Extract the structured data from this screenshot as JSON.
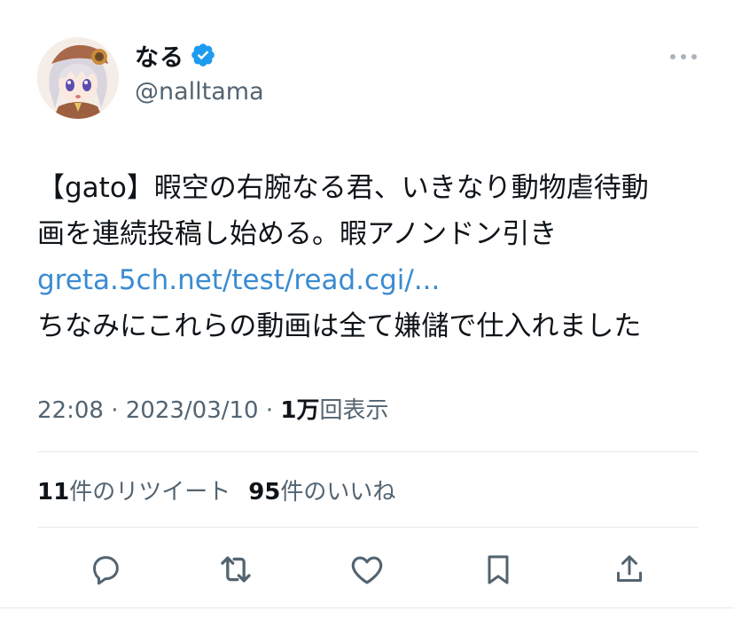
{
  "author": {
    "display_name": "なる",
    "handle": "@nalltama",
    "verified": true,
    "avatar": "anime-girl-avatar"
  },
  "tweet": {
    "lines": [
      "【gato】暇空の右腕なる君、いきなり動物虐待動",
      "画を連続投稿し始める。暇アノンドン引き"
    ],
    "link": "greta.5ch.net/test/read.cgi/...",
    "after_link": "ちなみにこれらの動画は全て嫌儲で仕入れました"
  },
  "meta": {
    "time": "22:08",
    "sep1": " · ",
    "date": "2023/03/10",
    "sep2": " · ",
    "views_count": "1万",
    "views_label": "回表示"
  },
  "stats": {
    "retweets_count": "11",
    "retweets_label": "件のリツイート",
    "likes_count": "95",
    "likes_label": "件のいいね"
  },
  "icons": {
    "more": "more-icon",
    "reply": "reply-icon",
    "retweet": "retweet-icon",
    "like": "like-icon",
    "bookmark": "bookmark-icon",
    "share": "share-icon"
  },
  "colors": {
    "text": "#0f1419",
    "secondary": "#536471",
    "link": "#3a8bd1",
    "verified": "#1d9bf0",
    "divider": "#e7e9ea"
  }
}
